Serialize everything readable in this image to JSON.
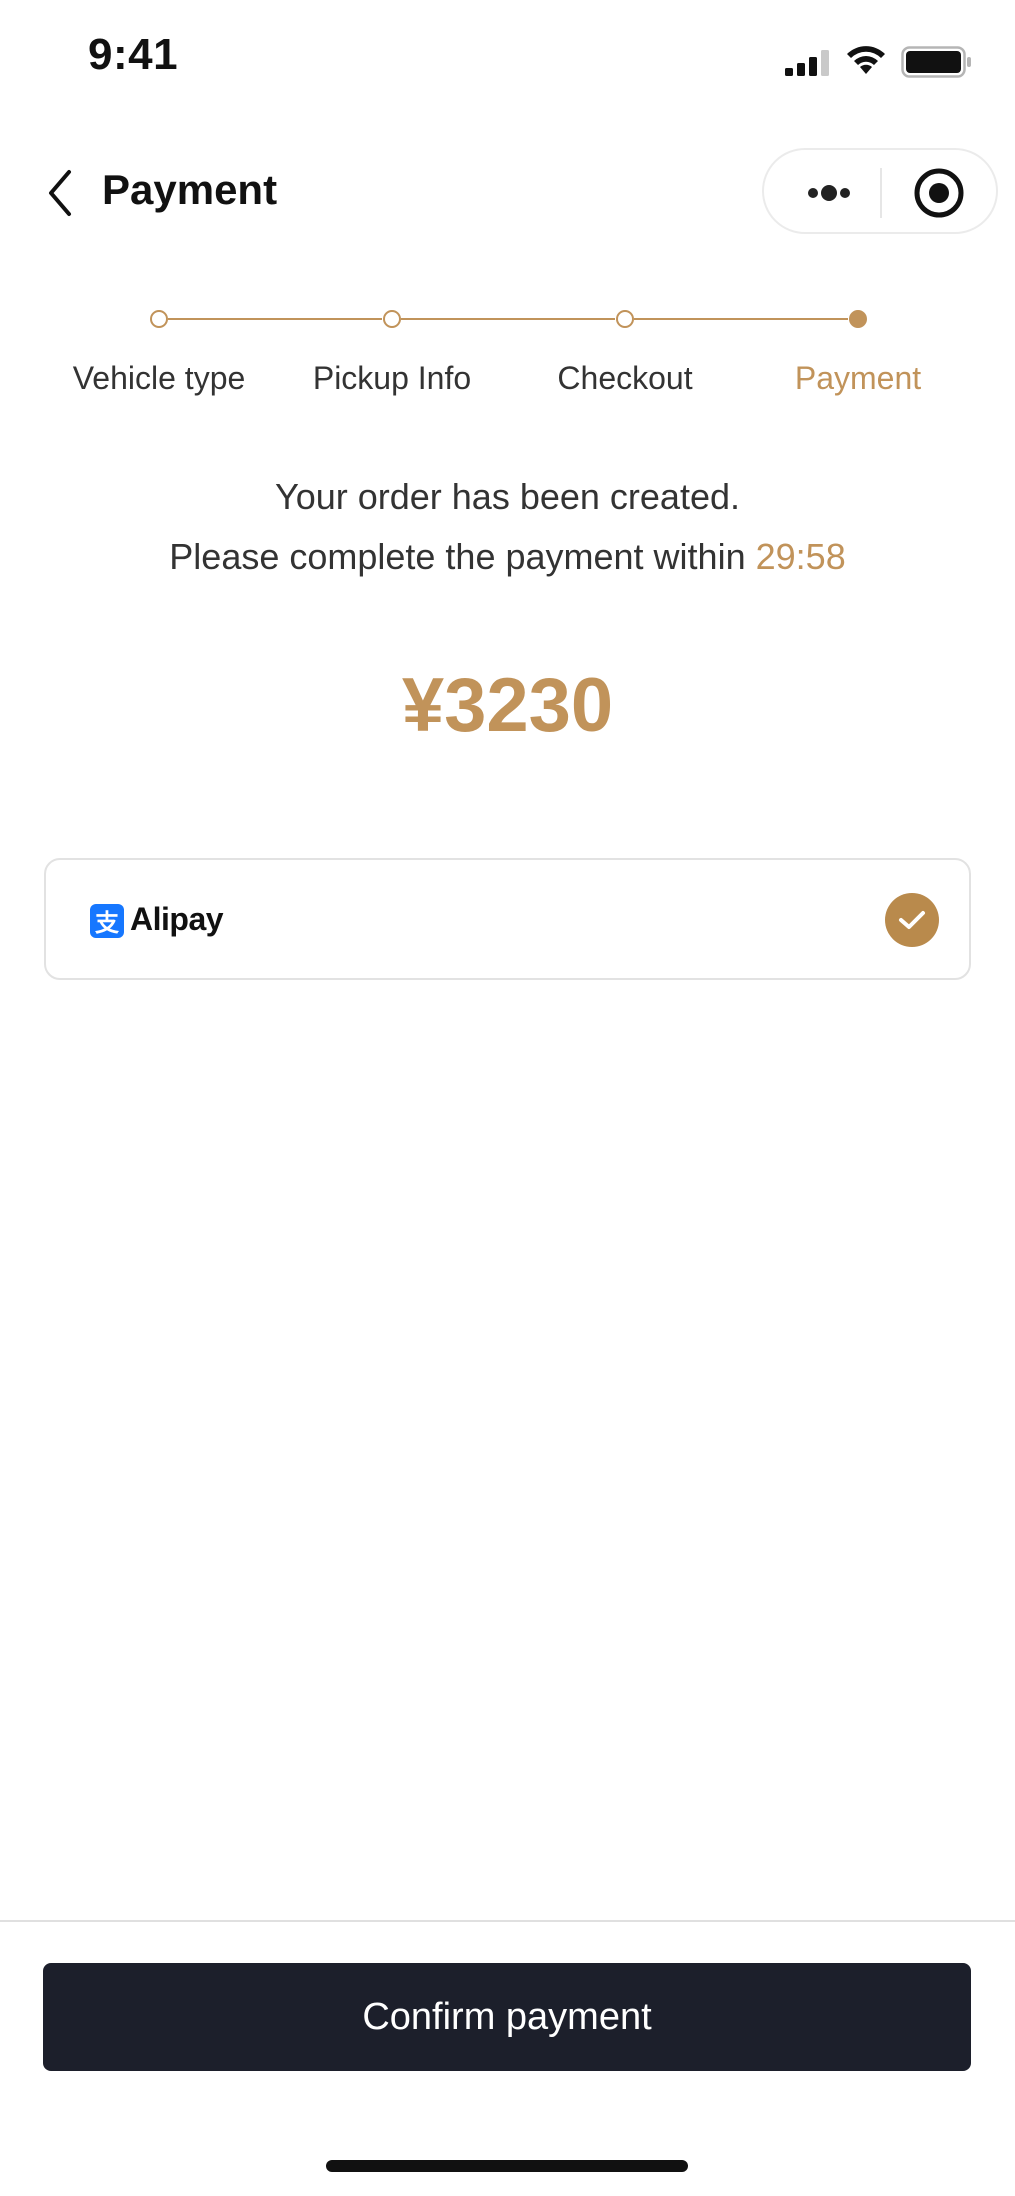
{
  "status_bar": {
    "time": "9:41",
    "icons": [
      "signal-icon",
      "wifi-icon",
      "battery-icon"
    ]
  },
  "nav": {
    "title": "Payment",
    "back_icon": "chevron-left-icon",
    "capsule_icons": [
      "more-icon",
      "target-icon"
    ]
  },
  "steps": [
    {
      "label": "Vehicle type",
      "active": false
    },
    {
      "label": "Pickup Info",
      "active": false
    },
    {
      "label": "Checkout",
      "active": false
    },
    {
      "label": "Payment",
      "active": true
    }
  ],
  "order": {
    "created_message": "Your order has been created.",
    "deadline_prefix": "Please complete the payment within",
    "countdown": "29:58",
    "amount": "¥3230"
  },
  "payment_methods": [
    {
      "name": "Alipay",
      "logo_glyph": "支",
      "selected": true
    }
  ],
  "footer": {
    "confirm_label": "Confirm payment"
  },
  "colors": {
    "accent": "#c1935a",
    "check_bg": "#b98a4c",
    "button_bg": "#1c1f2b",
    "alipay_blue": "#1677ff"
  }
}
